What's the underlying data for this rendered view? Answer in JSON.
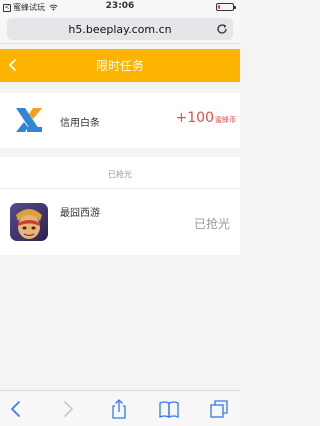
{
  "status_bar": {
    "back_glyph": "<",
    "carrier": "蜜蜂试玩",
    "time": "23:06",
    "battery_level": 0.12,
    "battery_color": "#e53a2f",
    "icons": [
      "back-to-app-icon",
      "wifi-icon",
      "battery-icon"
    ]
  },
  "browser": {
    "url": "h5.beeplay.com.cn",
    "reload_icon": "reload-icon"
  },
  "app_bar": {
    "title": "限时任务",
    "back_icon": "chevron-left-icon",
    "color": "#fdb400"
  },
  "task": {
    "name": "信用白条",
    "reward_amount": "+100",
    "reward_unit": "蜜蜂币",
    "reward_color": "#e84a4a",
    "logo_icon": "xinyong-baitiao-logo"
  },
  "claimed_section": {
    "header": "已抢光",
    "items": [
      {
        "name": "最囧西游",
        "status": "已抢光",
        "icon": "game-icon"
      }
    ]
  },
  "toolbar": {
    "accent": "#3478f6",
    "items": [
      "back-icon",
      "forward-icon",
      "share-icon",
      "bookmarks-icon",
      "tabs-icon"
    ]
  }
}
